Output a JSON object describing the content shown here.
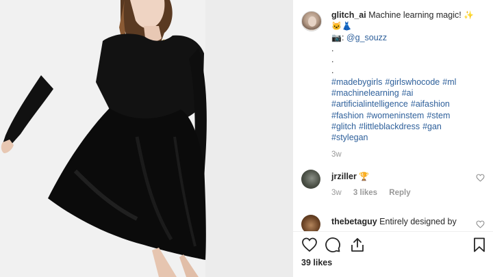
{
  "post": {
    "username": "glitch_ai",
    "caption_text": "Machine learning magic!",
    "caption_emoji": "✨",
    "caption_emoji_line2": "🐱👗",
    "credit_icon": "📷",
    "credit_prefix": ":",
    "credit_handle": "@g_souzz",
    "dots": [
      ".",
      ".",
      "."
    ],
    "hashtags": [
      "#madebygirls",
      "#girlswhocode",
      "#ml",
      "#machinelearning",
      "#ai",
      "#artificialintelligence",
      "#aifashion",
      "#fashion",
      "#womeninstem",
      "#stem",
      "#glitch",
      "#littleblackdress",
      "#gan",
      "#stylegan"
    ],
    "time": "3w"
  },
  "comments": [
    {
      "user": "jrziller",
      "text": "🏆",
      "time": "3w",
      "likes": "3 likes",
      "reply": "Reply"
    },
    {
      "user": "thebetaguy",
      "text": "Entirely designed by"
    }
  ],
  "actions": {
    "like_icon": "heart-icon",
    "comment_icon": "comment-icon",
    "share_icon": "share-icon",
    "save_icon": "bookmark-icon"
  },
  "likes": "39 likes",
  "colors": {
    "link": "#2d5f9a",
    "muted": "#999999",
    "text": "#262626"
  }
}
